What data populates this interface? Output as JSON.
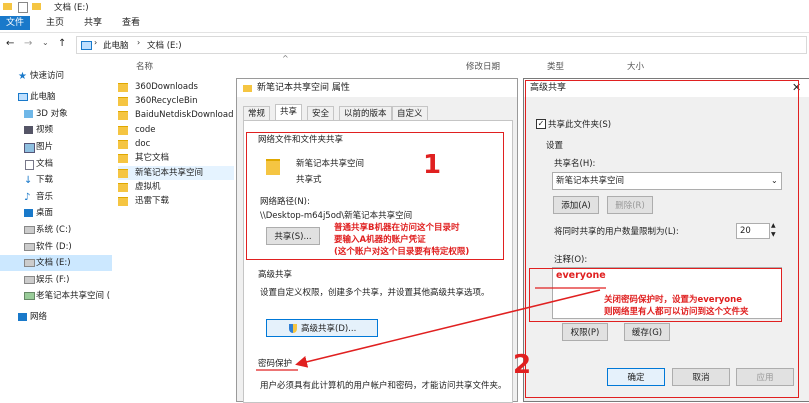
{
  "window": {
    "title": "文档 (E:)"
  },
  "ribbon": {
    "tabs": [
      "文件",
      "主页",
      "共享",
      "查看"
    ]
  },
  "address": {
    "path": [
      "此电脑",
      "文档 (E:)"
    ]
  },
  "nav": {
    "items": [
      {
        "label": "快速访问",
        "icon": "star-icon"
      },
      {
        "label": "此电脑",
        "icon": "computer-icon"
      },
      {
        "label": "3D 对象",
        "icon": "cube-icon"
      },
      {
        "label": "视频",
        "icon": "video-icon"
      },
      {
        "label": "图片",
        "icon": "picture-icon"
      },
      {
        "label": "文档",
        "icon": "document-icon"
      },
      {
        "label": "下载",
        "icon": "download-icon"
      },
      {
        "label": "音乐",
        "icon": "music-icon"
      },
      {
        "label": "桌面",
        "icon": "desktop-icon"
      },
      {
        "label": "系统 (C:)",
        "icon": "drive-icon"
      },
      {
        "label": "软件 (D:)",
        "icon": "drive-icon"
      },
      {
        "label": "文档 (E:)",
        "icon": "drive-icon"
      },
      {
        "label": "娱乐 (F:)",
        "icon": "drive-icon"
      },
      {
        "label": "老笔记本共享空间 (",
        "icon": "network-drive-icon"
      },
      {
        "label": "网络",
        "icon": "network-icon"
      }
    ]
  },
  "files": {
    "columns": [
      "名称",
      "修改日期",
      "类型",
      "大小"
    ],
    "items": [
      "360Downloads",
      "360RecycleBin",
      "BaiduNetdiskDownload",
      "code",
      "doc",
      "其它文档",
      "新笔记本共享空间",
      "虚拟机",
      "迅雷下载"
    ]
  },
  "props": {
    "title": "新笔记本共享空间 属性",
    "tabs": [
      "常规",
      "共享",
      "安全",
      "以前的版本",
      "自定义"
    ],
    "netshare_title": "网络文件和文件夹共享",
    "folder_name": "新笔记本共享空间",
    "share_state": "共享式",
    "netpath_label": "网络路径(N):",
    "netpath_value": "\\\\Desktop-m64j5od\\新笔记本共享空间",
    "share_button": "共享(S)...",
    "adv_title": "高级共享",
    "adv_desc": "设置自定义权限，创建多个共享，并设置其他高级共享选项。",
    "adv_button": "高级共享(D)...",
    "pwd_title": "密码保护",
    "pwd_desc": "用户必须具有此计算机的用户帐户和密码，才能访问共享文件夹。"
  },
  "adv": {
    "title": "高级共享",
    "share_checkbox": "共享此文件夹(S)",
    "settings_label": "设置",
    "share_name_label": "共享名(H):",
    "share_name_value": "新笔记本共享空间",
    "add_button": "添加(A)",
    "remove_button": "删除(R)",
    "limit_label": "将同时共享的用户数量限制为(L):",
    "limit_value": "20",
    "comment_label": "注释(O):",
    "comment_value": "everyone",
    "perm_button": "权限(P)",
    "cache_button": "缓存(G)",
    "ok_button": "确定",
    "cancel_button": "取消",
    "apply_button": "应用"
  },
  "annotations": {
    "num1": "1",
    "num2": "2",
    "note1": [
      "普通共享B机器在访问这个目录时",
      "要输入A机器的账户凭证",
      "(这个账户对这个目录要有特定权限)"
    ],
    "note2": [
      "关闭密码保护时，设置为everyone",
      "则网络里有人都可以访问到这个文件夹"
    ]
  }
}
